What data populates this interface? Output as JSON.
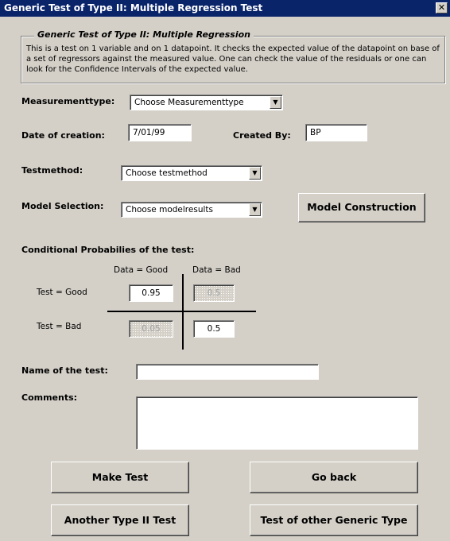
{
  "window": {
    "title": "Generic Test of Type II: Multiple Regression Test",
    "close_glyph": "✕"
  },
  "description": {
    "legend": "Generic Test of Type II: Multiple Regression",
    "text": "This is a test on 1 variable and on 1 datapoint. It checks the expected value of the datapoint on base of a set of regressors against the measured value. One can check the value of the residuals or one can look for the Confidence Intervals of the expected value."
  },
  "form": {
    "measurementtype": {
      "label": "Measurementtype:",
      "value": "Choose Measurementtype"
    },
    "date_of_creation": {
      "label": "Date of creation:",
      "value": "7/01/99"
    },
    "created_by": {
      "label": "Created By:",
      "value": "BP"
    },
    "testmethod": {
      "label": "Testmethod:",
      "value": "Choose testmethod"
    },
    "model_selection": {
      "label": "Model Selection:",
      "value": "Choose modelresults"
    },
    "model_construction_button": "Model Construction"
  },
  "probabilities": {
    "title": "Conditional Probabilies of the test:",
    "col_good": "Data = Good",
    "col_bad": "Data = Bad",
    "row_good": "Test = Good",
    "row_bad": "Test = Bad",
    "good_good": "0.95",
    "good_bad": "0.5",
    "bad_good": "0.05",
    "bad_bad": "0.5"
  },
  "name_of_test": {
    "label": "Name of the test:",
    "value": ""
  },
  "comments": {
    "label": "Comments:",
    "value": ""
  },
  "buttons": {
    "make_test": "Make Test",
    "go_back": "Go back",
    "another_type_ii": "Another Type II Test",
    "other_generic": "Test of other Generic Type"
  },
  "colors": {
    "titlebar": "#0a246a",
    "dialog_bg": "#d4d0c8"
  }
}
